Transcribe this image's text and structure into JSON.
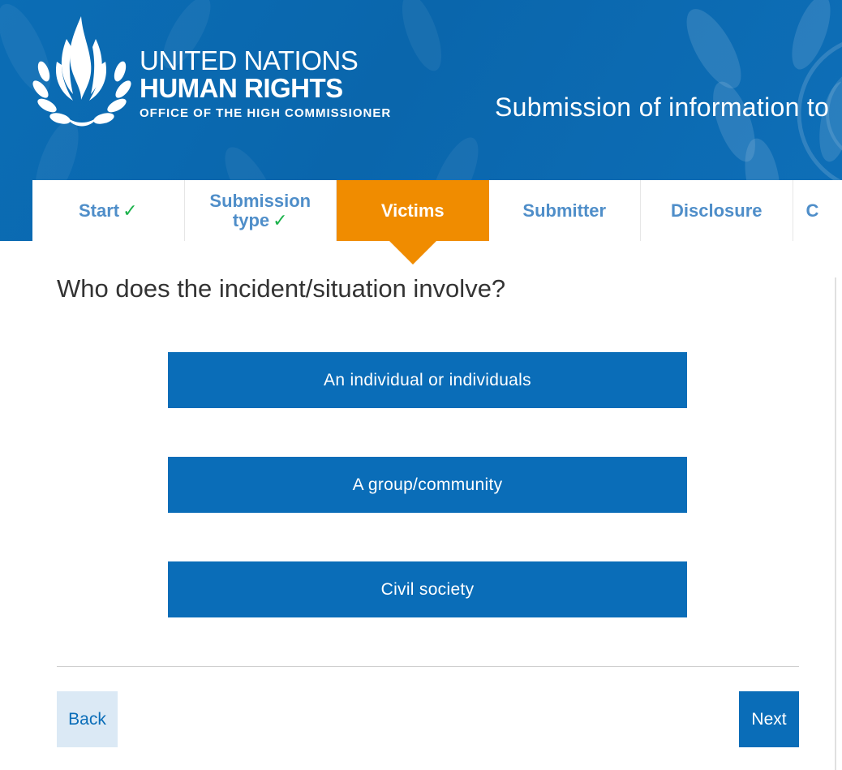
{
  "header": {
    "logo": {
      "line1": "UNITED NATIONS",
      "line2": "HUMAN RIGHTS",
      "line3": "OFFICE OF THE HIGH COMMISSIONER",
      "emblem_icon": "un-olive-branch-flame-emblem-icon"
    },
    "title": "Submission of information to"
  },
  "tabs": [
    {
      "label": "Start",
      "completed": true,
      "active": false
    },
    {
      "label": "Submission type",
      "label_line1": "Submission",
      "label_line2": "type",
      "completed": true,
      "active": false
    },
    {
      "label": "Victims",
      "completed": false,
      "active": true
    },
    {
      "label": "Submitter",
      "completed": false,
      "active": false
    },
    {
      "label": "Disclosure",
      "completed": false,
      "active": false
    },
    {
      "label": "C",
      "completed": false,
      "active": false
    }
  ],
  "check_mark": "✓",
  "main": {
    "question": "Who does the incident/situation involve?",
    "options": [
      {
        "label": "An individual or individuals"
      },
      {
        "label": "A group/community"
      },
      {
        "label": "Civil society"
      }
    ]
  },
  "nav": {
    "back_label": "Back",
    "next_label": "Next"
  },
  "colors": {
    "header_blue": "#0a66ac",
    "button_blue": "#0a6db8",
    "active_tab_orange": "#f08c00",
    "tab_text_blue": "#4f8ec9",
    "check_green": "#1bb24b",
    "back_button_bg": "#dbe9f5"
  }
}
